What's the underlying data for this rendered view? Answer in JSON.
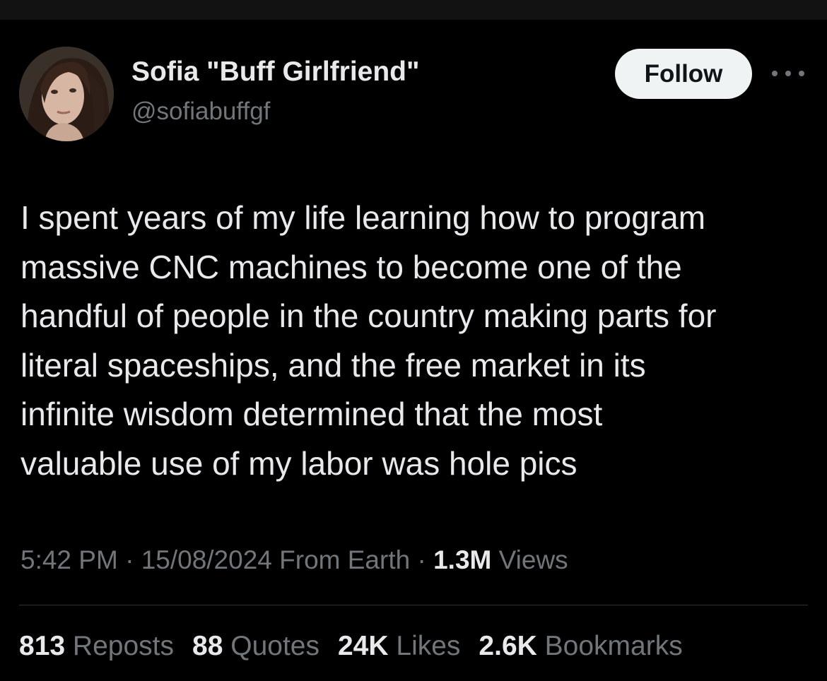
{
  "author": {
    "display_name": "Sofia \"Buff Girlfriend\"",
    "handle": "@sofiabuffgf"
  },
  "follow_label": "Follow",
  "more_icon": "more-horizontal-icon",
  "tweet_lines": [
    "I spent years of my life learning how to program",
    "massive CNC machines to become one of the",
    "handful of people in the country making parts for",
    "literal spaceships, and the free market in its",
    "infinite wisdom determined that the most",
    "valuable use of my labor was hole pics"
  ],
  "meta": {
    "time": "5:42 PM",
    "sep1": "·",
    "date": "15/08/2024",
    "source": "From Earth",
    "sep2": "·",
    "views_count": "1.3M",
    "views_label": "Views"
  },
  "stats": {
    "reposts": {
      "count": "813",
      "label": "Reposts"
    },
    "quotes": {
      "count": "88",
      "label": "Quotes"
    },
    "likes": {
      "count": "24K",
      "label": "Likes"
    },
    "bookmarks": {
      "count": "2.6K",
      "label": "Bookmarks"
    }
  },
  "colors": {
    "background": "#000000",
    "primary_text": "#e7e9ea",
    "secondary_text": "#71767b",
    "button_bg": "#eff3f4",
    "divider": "#2f3336"
  }
}
